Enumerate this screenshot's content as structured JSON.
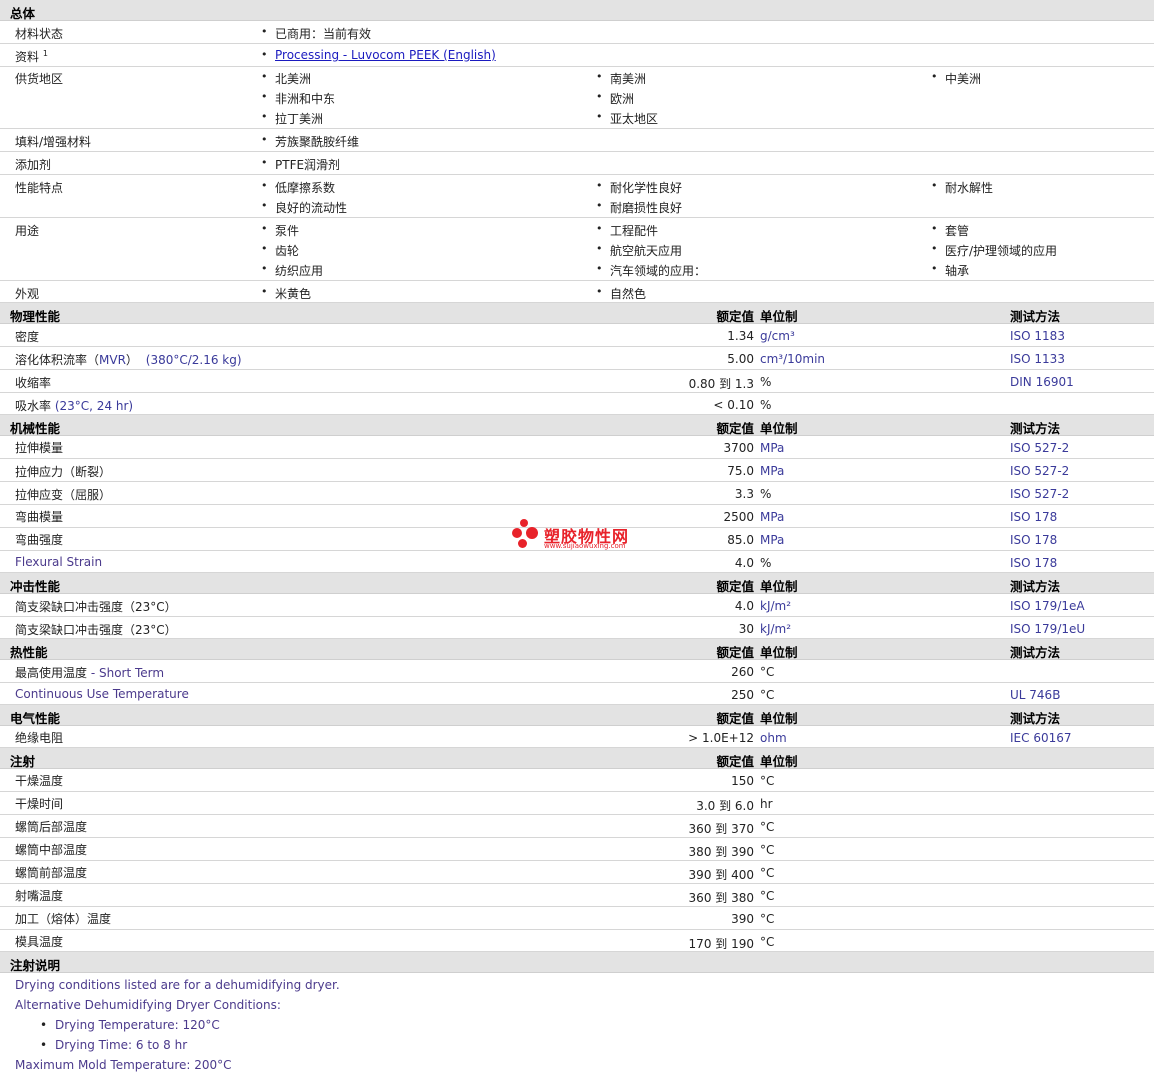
{
  "general": {
    "title": "总体",
    "status_label": "材料状态",
    "status_value": "已商用：当前有效",
    "doc_label": "资料",
    "doc_sup": "1",
    "doc_link": "Processing - Luvocom PEEK (English)",
    "regions_label": "供货地区",
    "regions": [
      "北美洲",
      "南美洲",
      "中美洲",
      "非洲和中东",
      "欧洲",
      "拉丁美洲",
      "亚太地区"
    ],
    "filler_label": "填料/增强材料",
    "filler_value": "芳族聚酰胺纤维",
    "additive_label": "添加剂",
    "additive_value": "PTFE润滑剂",
    "features_label": "性能特点",
    "features": [
      "低摩擦系数",
      "耐化学性良好",
      "耐水解性",
      "良好的流动性",
      "耐磨损性良好"
    ],
    "uses_label": "用途",
    "uses": [
      "泵件",
      "工程配件",
      "套管",
      "齿轮",
      "航空航天应用",
      "医疗/护理领域的应用",
      "纺织应用",
      "汽车领域的应用：",
      "轴承"
    ],
    "appearance_label": "外观",
    "appearance": [
      "米黄色",
      "自然色"
    ]
  },
  "col_headers": {
    "value": "额定值",
    "unit": "单位制",
    "method": "测试方法"
  },
  "physical": {
    "title": "物理性能",
    "rows": [
      {
        "label": "密度",
        "cond": "",
        "value": "1.34",
        "unit": "g/cm³",
        "method": "ISO 1183"
      },
      {
        "label": "溶化体积流率（",
        "label2": "MVR",
        "label3": "）",
        "cond": "(380°C/2.16 kg)",
        "value": "5.00",
        "unit": "cm³/10min",
        "method": "ISO 1133"
      },
      {
        "label": "收缩率",
        "cond": "",
        "value": "0.80 到  1.3",
        "unit": "%",
        "method": "DIN 16901"
      },
      {
        "label": "吸水率",
        "cond": "(23°C, 24 hr)",
        "value": "< 0.10",
        "unit": "%",
        "method": ""
      }
    ]
  },
  "mechanical": {
    "title": "机械性能",
    "rows": [
      {
        "label": "拉伸模量",
        "value": "3700",
        "unit": "MPa",
        "method": "ISO 527-2"
      },
      {
        "label": "拉伸应力（断裂）",
        "value": "75.0",
        "unit": "MPa",
        "method": "ISO 527-2"
      },
      {
        "label": "拉伸应变（屈服）",
        "value": "3.3",
        "unit": "%",
        "method": "ISO 527-2"
      },
      {
        "label": "弯曲模量",
        "value": "2500",
        "unit": "MPa",
        "method": "ISO 178"
      },
      {
        "label": "弯曲强度",
        "value": "85.0",
        "unit": "MPa",
        "method": "ISO 178"
      },
      {
        "label": "Flexural Strain",
        "value": "4.0",
        "unit": "%",
        "method": "ISO 178"
      }
    ]
  },
  "impact": {
    "title": "冲击性能",
    "rows": [
      {
        "label": "简支梁缺口冲击强度（23°C）",
        "value": "4.0",
        "unit": "kJ/m²",
        "method": "ISO 179/1eA"
      },
      {
        "label": "简支梁缺口冲击强度（23°C）",
        "value": "30",
        "unit": "kJ/m²",
        "method": "ISO 179/1eU"
      }
    ]
  },
  "thermal": {
    "title": "热性能",
    "rows": [
      {
        "label": "最高使用温度",
        "label2": " - Short Term",
        "value": "260",
        "unit": "°C",
        "method": ""
      },
      {
        "label": "Continuous Use Temperature",
        "value": "250",
        "unit": "°C",
        "method": "UL 746B"
      }
    ]
  },
  "electrical": {
    "title": "电气性能",
    "rows": [
      {
        "label": "绝缘电阻",
        "value": "> 1.0E+12",
        "unit": "ohm",
        "method": "IEC 60167"
      }
    ]
  },
  "injection": {
    "title": "注射",
    "rows": [
      {
        "label": "干燥温度",
        "value": "150",
        "unit": "°C"
      },
      {
        "label": "干燥时间",
        "value": "3.0 到  6.0",
        "unit": "hr"
      },
      {
        "label": "螺筒后部温度",
        "value": "360 到  370",
        "unit": "°C"
      },
      {
        "label": "螺筒中部温度",
        "value": "380 到  390",
        "unit": "°C"
      },
      {
        "label": "螺筒前部温度",
        "value": "390 到  400",
        "unit": "°C"
      },
      {
        "label": "射嘴温度",
        "value": "360 到  380",
        "unit": "°C"
      },
      {
        "label": "加工（熔体）温度",
        "value": "390",
        "unit": "°C"
      },
      {
        "label": "模具温度",
        "value": "170 到  190",
        "unit": "°C"
      }
    ]
  },
  "notes": {
    "title": "注射说明",
    "line1": "Drying conditions listed are for a dehumidifying dryer.",
    "line2": "Alternative Dehumidifying Dryer Conditions:",
    "bullet1": "Drying Temperature: 120°C",
    "bullet2": "Drying Time: 6 to 8 hr",
    "line3": "Maximum Mold Temperature: 200°C"
  },
  "watermark": {
    "title": "塑胶物性网",
    "url": "www.sujiaowuxing.com"
  }
}
